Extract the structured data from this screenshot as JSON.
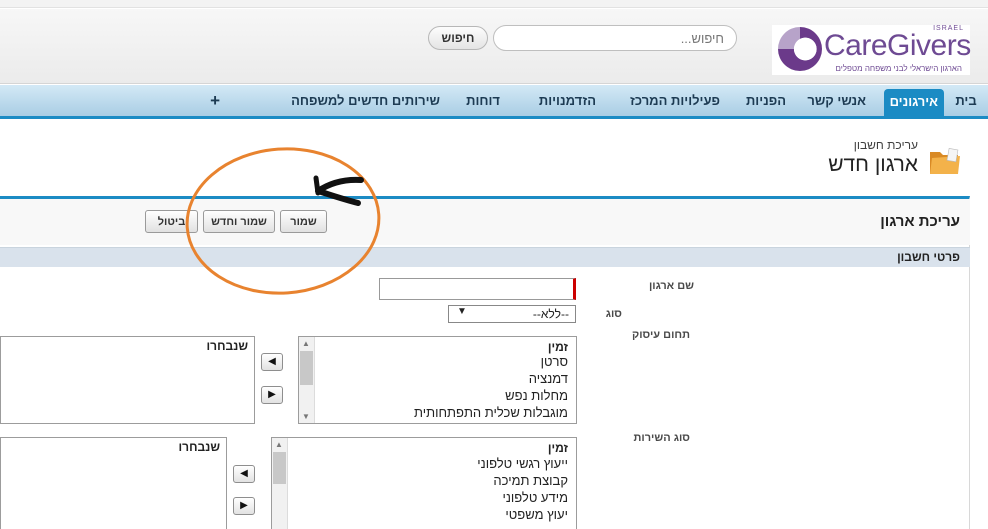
{
  "header": {
    "logo_name": "CareGivers",
    "logo_israel": "ISRAEL",
    "logo_tagline": "הארגון הישראלי לבני משפחה מטפלים",
    "search_placeholder": "חיפוש...",
    "search_button": "חיפוש"
  },
  "nav": {
    "tabs": [
      {
        "label": "בית"
      },
      {
        "label": "אירגונים"
      },
      {
        "label": "אנשי קשר"
      },
      {
        "label": "הפניות"
      },
      {
        "label": "פעילויות המרכז"
      },
      {
        "label": "הזדמנויות"
      },
      {
        "label": "דוחות"
      },
      {
        "label": "שירותים חדשים למשפחה"
      },
      {
        "label": "+"
      }
    ],
    "active_tab": "אירגונים"
  },
  "page": {
    "subtitle": "עריכת חשבון",
    "title": "ארגון חדש"
  },
  "form": {
    "edit_title": "עריכת ארגון",
    "save_label": "שמור",
    "save_new_label": "שמור וחדש",
    "cancel_label": "ביטול",
    "section_title": "פרטי חשבון",
    "fields": {
      "name_label": "שם ארגון",
      "name_value": "",
      "type_label": "סוג",
      "type_value": "--ללא--",
      "domain_label": "תחום עיסוק",
      "service_label": "סוג השירות"
    },
    "domain_list": {
      "available_header": "זמין",
      "selected_header": "שנבחרו",
      "options": [
        "סרטן",
        "דמנציה",
        "מחלות נפש",
        "מוגבלות שכלית התפתחותית"
      ]
    },
    "service_list": {
      "available_header": "זמין",
      "selected_header": "שנבחרו",
      "options": [
        "ייעוץ רגשי טלפוני",
        "קבוצת תמיכה",
        "מידע טלפוני",
        "יעוץ משפטי"
      ]
    }
  },
  "colors": {
    "accent": "#1b8bc4",
    "annotation": "#e8832f",
    "brand": "#6e4a93"
  }
}
